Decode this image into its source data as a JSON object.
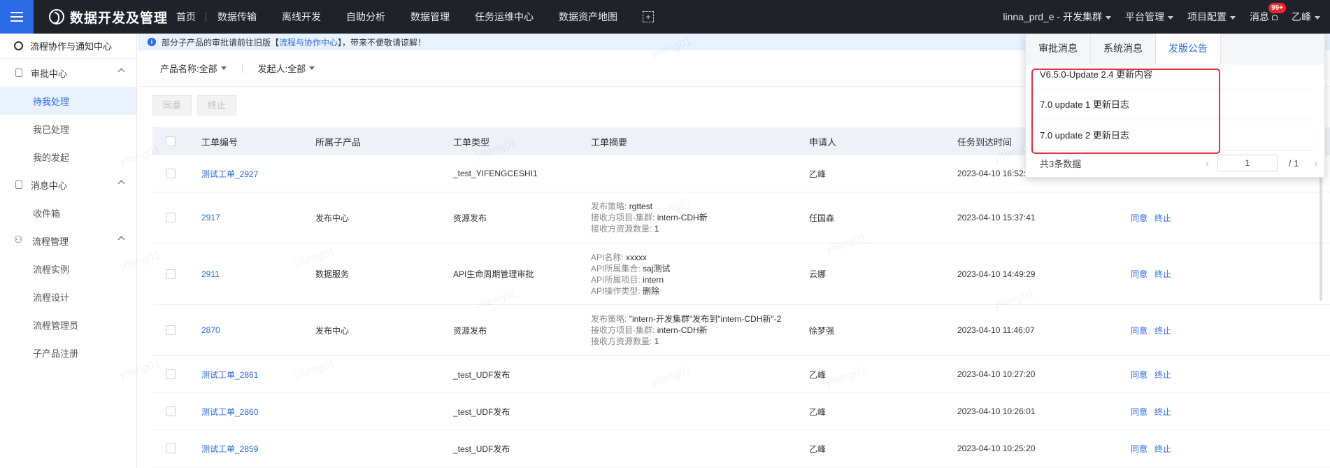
{
  "topbar": {
    "app_title": "数据开发及管理",
    "nav": [
      "首页",
      "数据传输",
      "离线开发",
      "自助分析",
      "数据管理",
      "任务运维中心",
      "数据资产地图"
    ],
    "project": "linna_prd_e - 开发集群",
    "platform": "平台管理",
    "project_config": "项目配置",
    "messages": "消息",
    "badge": "99+",
    "user": "乙峰"
  },
  "sidebar": {
    "header": "流程协作与通知中心",
    "groups": [
      {
        "label": "审批中心",
        "items": [
          "待我处理",
          "我已处理",
          "我的发起"
        ]
      },
      {
        "label": "消息中心",
        "items": [
          "收件箱"
        ]
      },
      {
        "label": "流程管理",
        "items": [
          "流程实例",
          "流程设计",
          "流程管理员",
          "子产品注册"
        ]
      }
    ]
  },
  "notice": {
    "prefix": "部分子产品的审批请前往旧版【",
    "link": "流程与协作中心",
    "suffix": "】，带来不便敬请谅解！"
  },
  "filters": {
    "product": "产品名称:全部",
    "initiator": "发起人:全部"
  },
  "actions": {
    "agree": "同意",
    "terminate": "终止"
  },
  "table": {
    "headers": [
      "工单编号",
      "所属子产品",
      "工单类型",
      "工单摘要",
      "申请人",
      "任务到达时间"
    ],
    "rows": [
      {
        "no": "测试工单_2927",
        "product": "",
        "type": "_test_YIFENGCESHI1",
        "summary": [],
        "applicant": "乙峰",
        "time": "2023-04-10 16:52:2",
        "ops": []
      },
      {
        "no": "2917",
        "product": "发布中心",
        "type": "资源发布",
        "summary": [
          [
            "发布策略:",
            "rgttest"
          ],
          [
            "接收方项目-集群:",
            "intern-CDH新"
          ],
          [
            "接收方资源数量:",
            "1"
          ]
        ],
        "applicant": "任国森",
        "time": "2023-04-10 15:37:41",
        "ops": [
          "同意",
          "终止"
        ]
      },
      {
        "no": "2911",
        "product": "数据服务",
        "type": "API生命周期管理审批",
        "summary": [
          [
            "API名称:",
            "xxxxx"
          ],
          [
            "API所属集合:",
            "saj测试"
          ],
          [
            "API所属项目:",
            "intern"
          ],
          [
            "API操作类型:",
            "删除"
          ]
        ],
        "applicant": "云娜",
        "time": "2023-04-10 14:49:29",
        "ops": [
          "同意",
          "终止"
        ]
      },
      {
        "no": "2870",
        "product": "发布中心",
        "type": "资源发布",
        "summary": [
          [
            "发布策略:",
            "\"intern-开发集群\"发布到\"intern-CDH新\"-2"
          ],
          [
            "接收方项目-集群:",
            "intern-CDH新"
          ],
          [
            "接收方资源数量:",
            "1"
          ]
        ],
        "applicant": "徐梦强",
        "time": "2023-04-10 11:46:07",
        "ops": [
          "同意",
          "终止"
        ]
      },
      {
        "no": "测试工单_2861",
        "product": "",
        "type": "_test_UDF发布",
        "summary": [],
        "applicant": "乙峰",
        "time": "2023-04-10 10:27:20",
        "ops": [
          "同意",
          "终止"
        ]
      },
      {
        "no": "测试工单_2860",
        "product": "",
        "type": "_test_UDF发布",
        "summary": [],
        "applicant": "乙峰",
        "time": "2023-04-10 10:26:01",
        "ops": [
          "同意",
          "终止"
        ]
      },
      {
        "no": "测试工单_2859",
        "product": "",
        "type": "_test_UDF发布",
        "summary": [],
        "applicant": "乙峰",
        "time": "2023-04-10 10:25:20",
        "ops": [
          "同意",
          "终止"
        ]
      }
    ]
  },
  "popover": {
    "tabs": [
      "审批消息",
      "系统消息",
      "发版公告"
    ],
    "active_tab": 2,
    "announcements": [
      "V6.5.0-Update 2.4 更新内容",
      "7.0 update 1 更新日志",
      "7.0 update 2 更新日志"
    ],
    "total": "共3条数据",
    "page": "1",
    "pages": "/ 1"
  },
  "watermark": "yifeng01",
  "colors": {
    "accent": "#2b6be6",
    "topbar": "#1f2329",
    "highlight": "#e3323b"
  }
}
